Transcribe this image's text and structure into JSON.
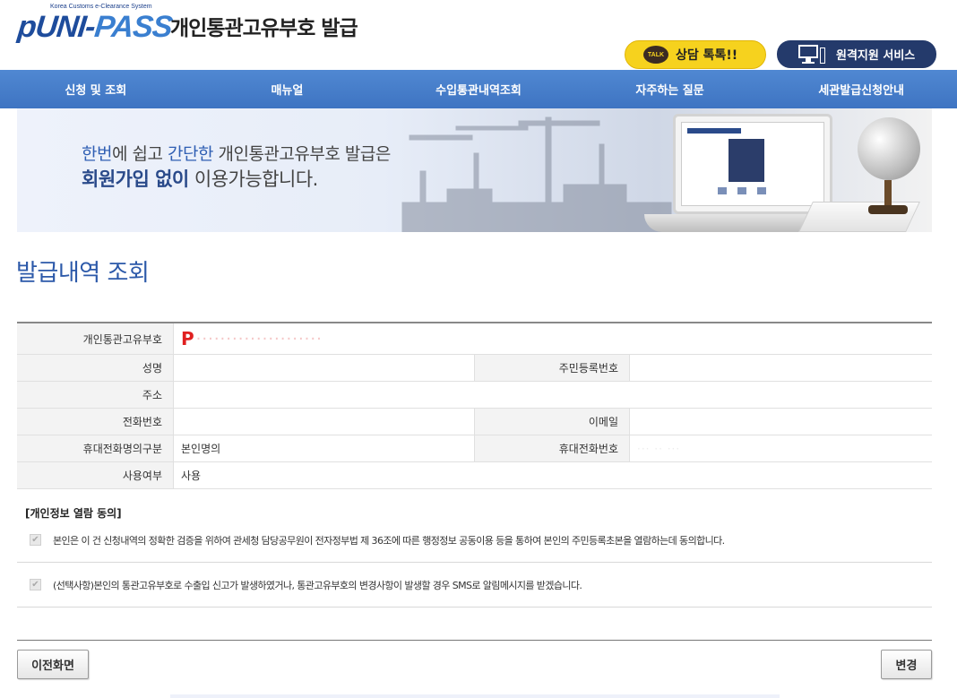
{
  "header": {
    "logo_sub": "Korea Customs e-Clearance System",
    "logo_main_a": "UNI-",
    "logo_main_b": "PASS",
    "logo_main_p": "p",
    "site_title": "개인통관고유부호 발급",
    "talk_badge": "TALK",
    "talk_label": "상담 톡톡!!",
    "remote_label": "원격지원 서비스"
  },
  "nav": {
    "items": [
      {
        "label": "신청 및 조회"
      },
      {
        "label": "매뉴얼"
      },
      {
        "label": "수입통관내역조회"
      },
      {
        "label": "자주하는 질문"
      },
      {
        "label": "세관발급신청안내"
      }
    ]
  },
  "banner": {
    "l1_hl1": "한번",
    "l1_t1": "에 쉽고 ",
    "l1_hl2": "간단한",
    "l1_t2": " 개인통관고유부호 발급은",
    "l2_hl": "회원가입 없이",
    "l2_rest": " 이용가능합니다."
  },
  "page_title": "발급내역 조회",
  "info": {
    "code_label": "개인통관고유부호",
    "code_prefix": "P",
    "code_masked": "·····················",
    "name_label": "성명",
    "name_value": "",
    "rrn_label": "주민등록번호",
    "rrn_value": "",
    "address_label": "주소",
    "address_value": "",
    "phone_label": "전화번호",
    "phone_value": "",
    "email_label": "이메일",
    "email_value": "",
    "mobile_owner_label": "휴대전화명의구분",
    "mobile_owner_value": "본인명의",
    "mobile_label": "휴대전화번호",
    "mobile_value": "··· ·· ···",
    "usage_label": "사용여부",
    "usage_value": "사용"
  },
  "consent": {
    "title": "[개인정보 열람 동의]",
    "item1": "본인은 이 건 신청내역의 정확한 검증을 위하여 관세청 담당공무원이 전자정부법 제 36조에 따른 행정정보 공동이용 등을 통하여 본인의 주민등록초본을 열람하는데 동의합니다.",
    "item1_checked": true,
    "item2": "(선택사항)본인의 통관고유부호로 수출입 신고가 발생하였거나, 통관고유부호의 변경사항이 발생할 경우 SMS로 알림메시지를 받겠습니다.",
    "item2_checked": true
  },
  "buttons": {
    "prev": "이전화면",
    "change": "변경"
  },
  "colors": {
    "nav": "#4a80cb",
    "title": "#2c59a9",
    "code": "#e02020",
    "talk": "#f6d21e",
    "remote": "#243a6b"
  }
}
